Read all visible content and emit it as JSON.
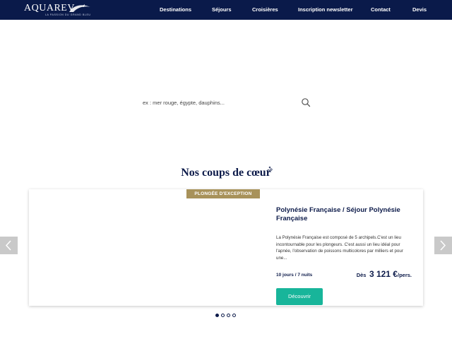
{
  "brand": {
    "name": "AQUAREV",
    "tagline": "LA PASSION DU GRAND BLEU"
  },
  "nav": {
    "items": [
      {
        "label": "Destinations"
      },
      {
        "label": "Séjours"
      },
      {
        "label": "Croisières"
      },
      {
        "label": "Inscription newsletter"
      },
      {
        "label": "Contact"
      },
      {
        "label": "Devis"
      }
    ]
  },
  "search": {
    "placeholder": "ex : mer rouge, égypte, dauphins...",
    "icon": "search-icon"
  },
  "section": {
    "title": "Nos coups de cœur",
    "icon": "bubbles-icon"
  },
  "card": {
    "badge": "PLONGÉE D'EXCEPTION",
    "title": "Polynésie Française / Séjour Polynésie Française",
    "description": "La Polynésie Française est composé de 5 archipels.C'est un lieu incontournable pour les plongeurs. C'est aussi un lieu idéal pour l'apnée, l'observation de poissons multicolores par milliers et pour une...",
    "duration": "10 jours / 7 nuits",
    "price_from": "Dès",
    "price_value": "3 121 €",
    "price_unit": "/pers.",
    "cta_label": "Découvrir"
  },
  "carousel": {
    "prev_icon": "chevron-left-icon",
    "next_icon": "chevron-right-icon",
    "dot_count": 4,
    "active_index": 0
  },
  "colors": {
    "header_bg": "#0a1a4a",
    "badge_bg": "#a8925a",
    "cta_bg": "#18b59a",
    "title_color": "#0d1b4a"
  }
}
